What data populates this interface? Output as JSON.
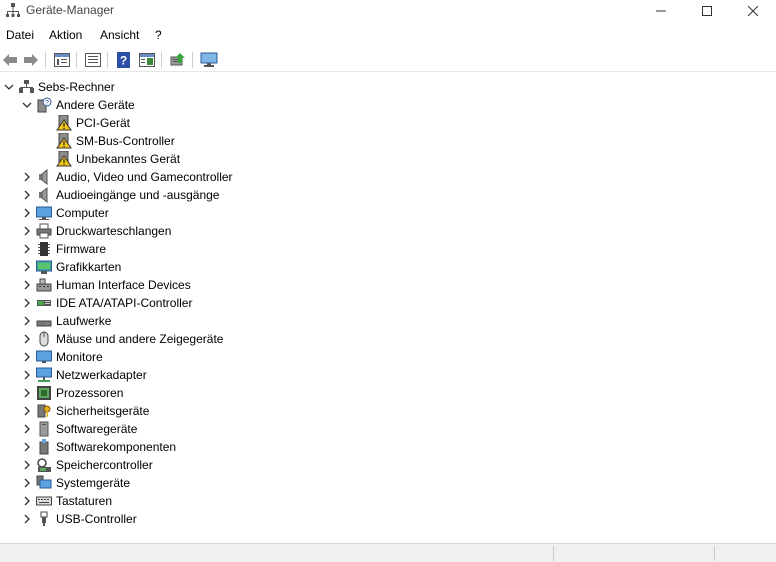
{
  "window": {
    "title": "Geräte-Manager"
  },
  "menu": {
    "items": [
      "Datei",
      "Aktion",
      "Ansicht",
      "?"
    ]
  },
  "toolbar": {
    "buttons": [
      "back-icon",
      "forward-icon",
      "properties-list-icon",
      "view-icon",
      "help-icon",
      "view-details-icon",
      "scan-hardware-icon",
      "monitor-icon"
    ]
  },
  "tree": {
    "root": "Sebs-Rechner",
    "expanded": {
      "label": "Andere Geräte",
      "children": [
        "PCI-Gerät",
        "SM-Bus-Controller",
        "Unbekanntes Gerät"
      ]
    },
    "categories": [
      "Audio, Video und Gamecontroller",
      "Audioeingänge und -ausgänge",
      "Computer",
      "Druckwarteschlangen",
      "Firmware",
      "Grafikkarten",
      "Human Interface Devices",
      "IDE ATA/ATAPI-Controller",
      "Laufwerke",
      "Mäuse und andere Zeigegeräte",
      "Monitore",
      "Netzwerkadapter",
      "Prozessoren",
      "Sicherheitsgeräte",
      "Softwaregeräte",
      "Softwarekomponenten",
      "Speichercontroller",
      "Systemgeräte",
      "Tastaturen",
      "USB-Controller"
    ]
  }
}
